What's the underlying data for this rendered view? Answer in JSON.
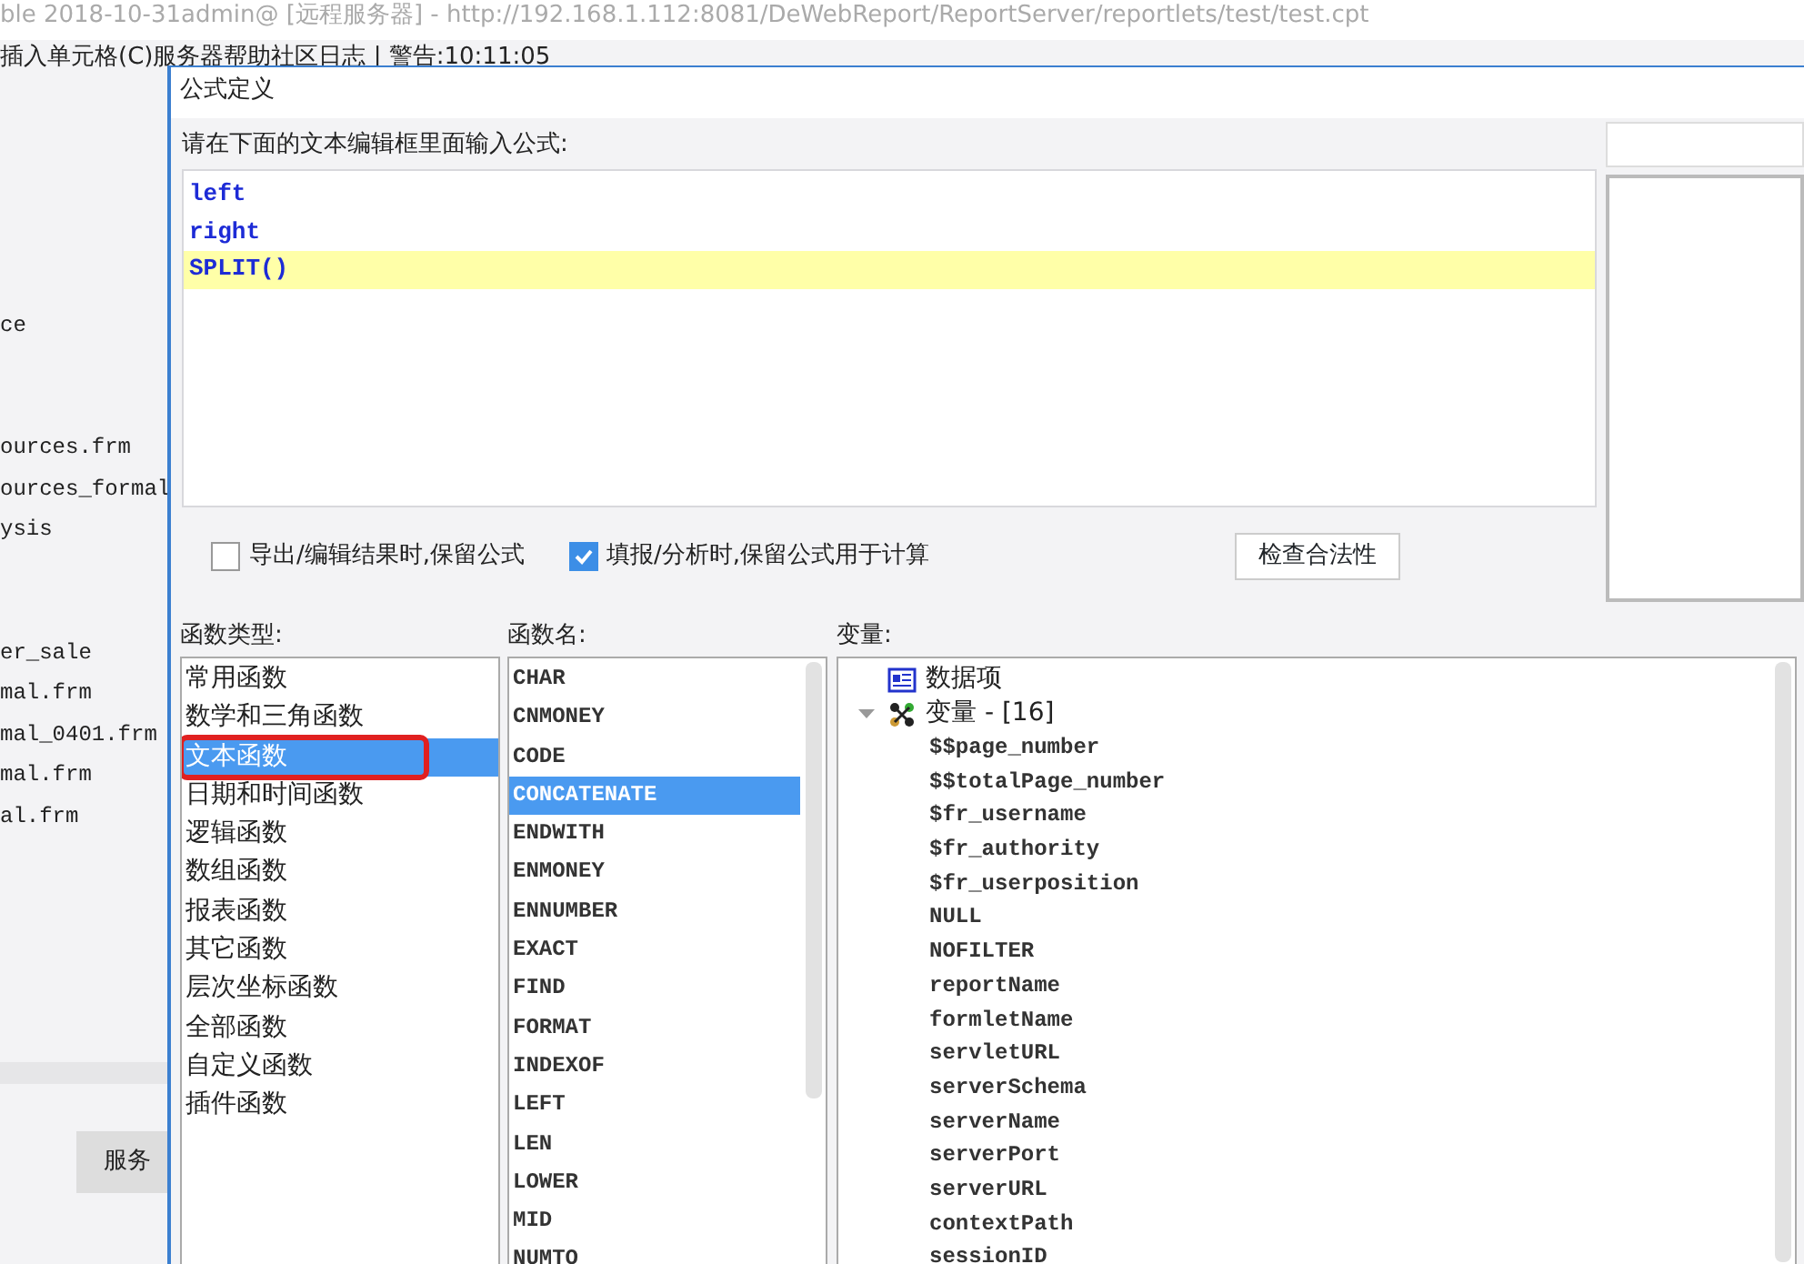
{
  "app": {
    "title": "ble 2018-10-31admin@ [远程服务器] - http://192.168.1.112:8081/DeWebReport/ReportServer/reportlets/test/test.cpt",
    "menu": [
      "插入",
      "单元格(C)",
      "服务器",
      "帮助",
      "社区"
    ],
    "status": "日志 | 警告:10:11:05",
    "file_groups": [
      [
        "ce"
      ],
      [
        "ources.frm",
        "ources_formal",
        "ysis"
      ],
      [
        "er_sale",
        "mal.frm",
        "mal_0401.frm",
        "mal.frm",
        "al.frm"
      ]
    ],
    "bottom_tab": "服务"
  },
  "dialog": {
    "title": "公式定义",
    "prompt": "请在下面的文本编辑框里面输入公式:",
    "editor_lines": [
      {
        "text": "left",
        "current": false
      },
      {
        "text": "right",
        "current": false
      },
      {
        "text": "SPLIT()",
        "current": true
      }
    ],
    "options": [
      {
        "label": "导出/编辑结果时,保留公式",
        "checked": false
      },
      {
        "label": "填报/分析时,保留公式用于计算",
        "checked": true
      }
    ],
    "check_button": "检查合法性",
    "categories_label": "函数类型:",
    "categories": [
      {
        "label": "常用函数",
        "selected": false,
        "highlighted": false
      },
      {
        "label": "数学和三角函数",
        "selected": false,
        "highlighted": false
      },
      {
        "label": "文本函数",
        "selected": true,
        "highlighted": true
      },
      {
        "label": "日期和时间函数",
        "selected": false,
        "highlighted": false
      },
      {
        "label": "逻辑函数",
        "selected": false,
        "highlighted": false
      },
      {
        "label": "数组函数",
        "selected": false,
        "highlighted": false
      },
      {
        "label": "报表函数",
        "selected": false,
        "highlighted": false
      },
      {
        "label": "其它函数",
        "selected": false,
        "highlighted": false
      },
      {
        "label": "层次坐标函数",
        "selected": false,
        "highlighted": false
      },
      {
        "label": "全部函数",
        "selected": false,
        "highlighted": false
      },
      {
        "label": "自定义函数",
        "selected": false,
        "highlighted": false
      },
      {
        "label": "插件函数",
        "selected": false,
        "highlighted": false
      }
    ],
    "functions_label": "函数名:",
    "functions": [
      {
        "label": "CHAR",
        "selected": false
      },
      {
        "label": "CNMONEY",
        "selected": false
      },
      {
        "label": "CODE",
        "selected": false
      },
      {
        "label": "CONCATENATE",
        "selected": true
      },
      {
        "label": "ENDWITH",
        "selected": false
      },
      {
        "label": "ENMONEY",
        "selected": false
      },
      {
        "label": "ENNUMBER",
        "selected": false
      },
      {
        "label": "EXACT",
        "selected": false
      },
      {
        "label": "FIND",
        "selected": false
      },
      {
        "label": "FORMAT",
        "selected": false
      },
      {
        "label": "INDEXOF",
        "selected": false
      },
      {
        "label": "LEFT",
        "selected": false
      },
      {
        "label": "LEN",
        "selected": false
      },
      {
        "label": "LOWER",
        "selected": false
      },
      {
        "label": "MID",
        "selected": false
      },
      {
        "label": "NUMTO",
        "selected": false
      }
    ],
    "variables_label": "变量:",
    "variables": [
      {
        "kind": "data",
        "label": "数据项"
      },
      {
        "kind": "group",
        "label": "变量 - [16]",
        "expanded": true,
        "children": [
          {
            "label": "$$page_number"
          },
          {
            "label": "$$totalPage_number"
          },
          {
            "label": "$fr_username"
          },
          {
            "label": "$fr_authority"
          },
          {
            "label": "$fr_userposition"
          },
          {
            "label": "NULL"
          },
          {
            "label": "NOFILTER"
          },
          {
            "label": "reportName"
          },
          {
            "label": "formletName"
          },
          {
            "label": "servletURL"
          },
          {
            "label": "serverSchema"
          },
          {
            "label": "serverName"
          },
          {
            "label": "serverPort"
          },
          {
            "label": "serverURL"
          },
          {
            "label": "contextPath"
          },
          {
            "label": "sessionID"
          }
        ]
      }
    ]
  }
}
